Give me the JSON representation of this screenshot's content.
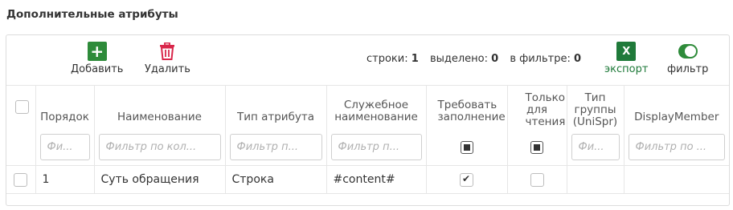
{
  "section": {
    "title": "Дополнительные атрибуты"
  },
  "toolbar": {
    "add_label": "Добавить",
    "delete_label": "Удалить",
    "stats": {
      "rows_label": "строки:",
      "rows_value": "1",
      "selected_label": "выделено:",
      "selected_value": "0",
      "filtered_label": "в фильтре:",
      "filtered_value": "0"
    },
    "export_icon_text": "X",
    "export_label": "экспорт",
    "filter_label": "фильтр",
    "filter_on": true
  },
  "colors": {
    "accent": "#2e8b3a",
    "delete": "#d9264a",
    "excel": "#1f7a3a"
  },
  "table": {
    "columns": [
      {
        "label": "Порядок",
        "filter": "Фи..."
      },
      {
        "label": "Наименование",
        "filter": "Фильтр по кол..."
      },
      {
        "label": "Тип атрибута",
        "filter": "Фильтр п..."
      },
      {
        "label": "Служебное наименование",
        "filter": "Фильтр п..."
      },
      {
        "label": "Требовать заполнение",
        "filter": ""
      },
      {
        "label": "Только для чтения",
        "filter": ""
      },
      {
        "label": "Тип группы (UniSpr)",
        "filter": "Фи..."
      },
      {
        "label": "DisplayMember",
        "filter": "Фильтр по ..."
      }
    ],
    "rows": [
      {
        "order": "1",
        "name": "Суть обращения",
        "type": "Строка",
        "service_name": "#content#",
        "required": true,
        "readonly": false,
        "group_type": "",
        "display_member": ""
      }
    ]
  }
}
